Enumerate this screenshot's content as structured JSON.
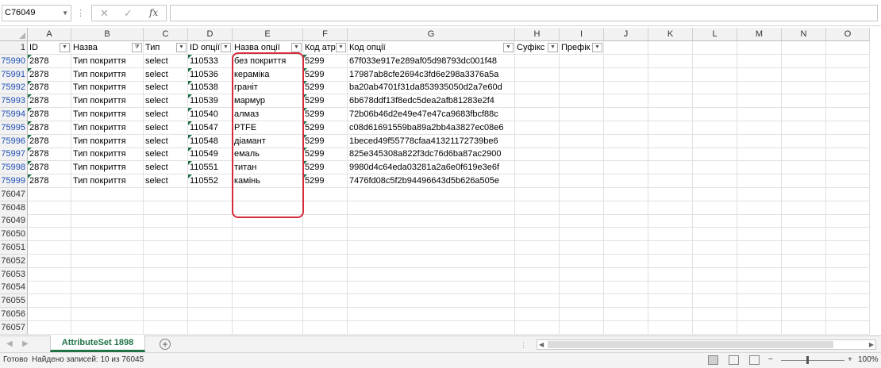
{
  "formula_bar": {
    "name_box": "C76049",
    "cancel_symbol": "✕",
    "enter_symbol": "✓",
    "fx_symbol": "fx",
    "formula_value": ""
  },
  "columns": [
    "A",
    "B",
    "C",
    "D",
    "E",
    "F",
    "G",
    "H",
    "I",
    "J",
    "K",
    "L",
    "M",
    "N",
    "O"
  ],
  "header_row": {
    "row_number": "1",
    "cells": [
      "ID",
      "Назва",
      "Тип",
      "ID опції",
      "Назва опції",
      "Код атр",
      "Код опції",
      "Суфікс",
      "Префік"
    ]
  },
  "data_rows": [
    {
      "row": "75990",
      "id": "2878",
      "name": "Тип покриття",
      "type": "select",
      "option_id": "110533",
      "option_name": "без покриття",
      "attr_code": "5299",
      "option_code": "67f033e917e289af05d98793dc001f48"
    },
    {
      "row": "75991",
      "id": "2878",
      "name": "Тип покриття",
      "type": "select",
      "option_id": "110536",
      "option_name": "кераміка",
      "attr_code": "5299",
      "option_code": "17987ab8cfe2694c3fd6e298a3376a5a"
    },
    {
      "row": "75992",
      "id": "2878",
      "name": "Тип покриття",
      "type": "select",
      "option_id": "110538",
      "option_name": "граніт",
      "attr_code": "5299",
      "option_code": "ba20ab4701f31da853935050d2a7e60d"
    },
    {
      "row": "75993",
      "id": "2878",
      "name": "Тип покриття",
      "type": "select",
      "option_id": "110539",
      "option_name": "мармур",
      "attr_code": "5299",
      "option_code": "6b678ddf13f8edc5dea2afb81283e2f4"
    },
    {
      "row": "75994",
      "id": "2878",
      "name": "Тип покриття",
      "type": "select",
      "option_id": "110540",
      "option_name": "алмаз",
      "attr_code": "5299",
      "option_code": "72b06b46d2e49e47e47ca9683fbcf88c"
    },
    {
      "row": "75995",
      "id": "2878",
      "name": "Тип покриття",
      "type": "select",
      "option_id": "110547",
      "option_name": "PTFE",
      "attr_code": "5299",
      "option_code": "c08d61691559ba89a2bb4a3827ec08e6"
    },
    {
      "row": "75996",
      "id": "2878",
      "name": "Тип покриття",
      "type": "select",
      "option_id": "110548",
      "option_name": "діамант",
      "attr_code": "5299",
      "option_code": "1beced49f55778cfaa41321172739be6"
    },
    {
      "row": "75997",
      "id": "2878",
      "name": "Тип покриття",
      "type": "select",
      "option_id": "110549",
      "option_name": "емаль",
      "attr_code": "5299",
      "option_code": "825e345308a822f3dc76d6ba87ac2900"
    },
    {
      "row": "75998",
      "id": "2878",
      "name": "Тип покриття",
      "type": "select",
      "option_id": "110551",
      "option_name": "титан",
      "attr_code": "5299",
      "option_code": "9980d4c64eda03281a2a6e0f619e3e6f"
    },
    {
      "row": "75999",
      "id": "2878",
      "name": "Тип покриття",
      "type": "select",
      "option_id": "110552",
      "option_name": "камінь",
      "attr_code": "5299",
      "option_code": "7476fd08c5f2b94496643d5b626a505e"
    }
  ],
  "empty_rows": [
    "76047",
    "76048",
    "76049",
    "76050",
    "76051",
    "76052",
    "76053",
    "76054",
    "76055",
    "76056",
    "76057"
  ],
  "sheet_tab": "AttributeSet 1898",
  "add_sheet_symbol": "+",
  "status": {
    "ready": "Готово",
    "records_found": "Найдено записей: 10 из 76045",
    "zoom": "100%",
    "zoom_minus": "−",
    "zoom_plus": "+"
  },
  "colors": {
    "accent_green": "#217346",
    "filtered_row_blue": "#1f4fb5",
    "highlight_red": "#d62b3a"
  }
}
